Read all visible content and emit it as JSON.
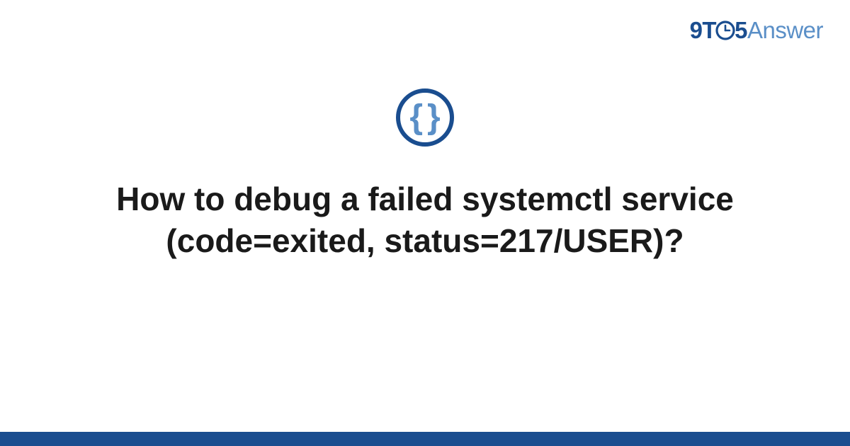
{
  "logo": {
    "part1": "9",
    "part2": "T",
    "part3": "5",
    "part4": "Answer"
  },
  "icon": {
    "brace_left": "{",
    "brace_right": "}"
  },
  "title": "How to debug a failed systemctl service (code=exited, status=217/USER)?",
  "colors": {
    "brand_dark": "#1a4d8f",
    "brand_light": "#5a8fc7",
    "text": "#1a1a1a"
  }
}
